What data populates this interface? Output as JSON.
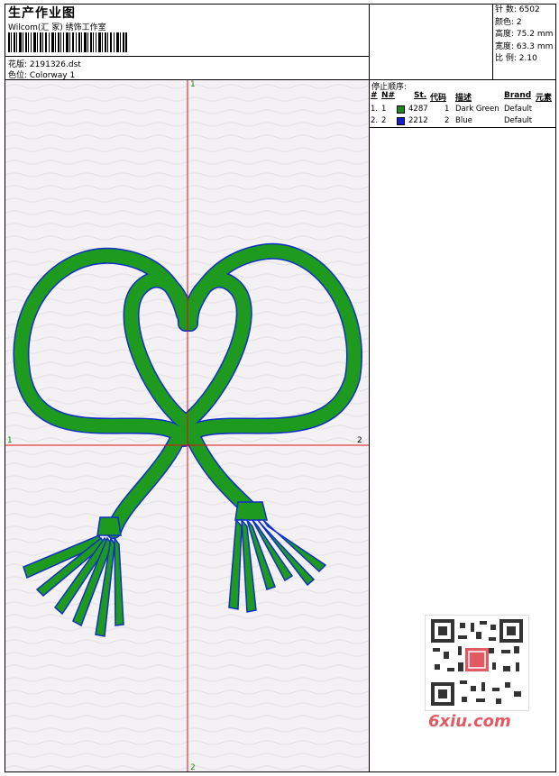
{
  "header": {
    "title": "生产作业图",
    "company": "Wilcom(汇 冢) 绣饰工作室",
    "design_label": "花版:",
    "design_file": "2191326.dst",
    "colorway_label": "色位:",
    "colorway": "Colorway 1"
  },
  "stats": [
    {
      "label": "针 数:",
      "value": "6502"
    },
    {
      "label": "颜色:",
      "value": "2"
    },
    {
      "label": "高度:",
      "value": "75.2 mm"
    },
    {
      "label": "宽度:",
      "value": "63.3 mm"
    },
    {
      "label": "比 例:",
      "value": "2.10"
    }
  ],
  "stop_sequence": {
    "title": "停止顺序:",
    "columns": [
      "#",
      "N#",
      "St.",
      "代码",
      "描述",
      "Brand",
      "元素"
    ],
    "rows": [
      {
        "index": "1.",
        "needle": "1",
        "code": "4287",
        "code2": "1",
        "description": "Dark Green",
        "brand": "Default",
        "color": "#1a8a1a"
      },
      {
        "index": "2.",
        "needle": "2",
        "code": "2212",
        "code2": "2",
        "description": "Blue",
        "brand": "Default",
        "color": "#1020d0"
      }
    ]
  },
  "axis_labels": {
    "top": "1",
    "bottom": "2",
    "left": "1",
    "right": "2"
  },
  "watermark": "6xiu.com",
  "colors": {
    "thread_green": "#1e9a1e",
    "outline_blue": "#1030c8",
    "axis_red": "#e01010",
    "canvas": "#f3f1f3"
  }
}
